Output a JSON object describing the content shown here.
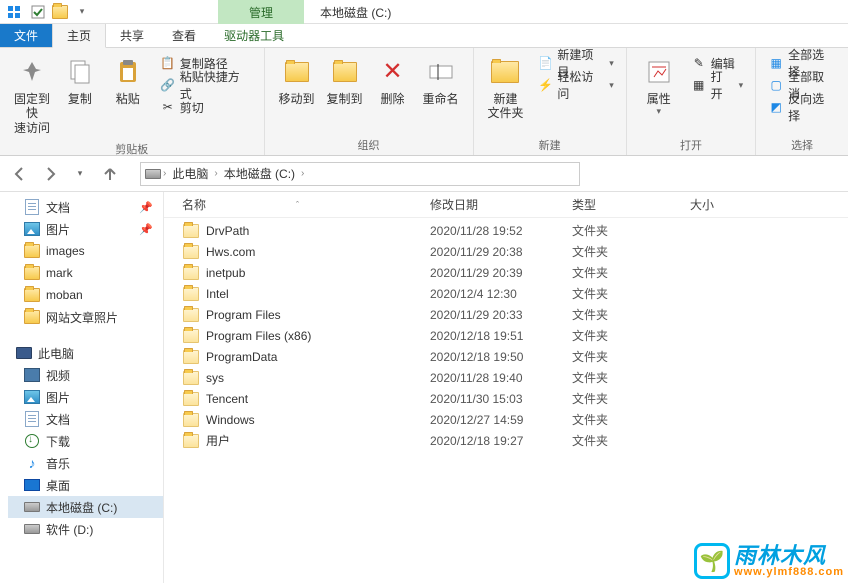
{
  "title": "本地磁盘 (C:)",
  "manage_label": "管理",
  "tabs": {
    "file": "文件",
    "home": "主页",
    "share": "共享",
    "view": "查看",
    "tools": "驱动器工具"
  },
  "ribbon": {
    "quick": {
      "pin": "固定到快\n速访问",
      "copy": "复制",
      "paste": "粘贴",
      "copypath": "复制路径",
      "pasteshortcut": "粘贴快捷方式",
      "cut": "剪切",
      "group": "剪贴板"
    },
    "org": {
      "moveto": "移动到",
      "copyto": "复制到",
      "delete": "删除",
      "rename": "重命名",
      "group": "组织"
    },
    "new": {
      "newfolder": "新建\n文件夹",
      "newitem": "新建项目",
      "easyaccess": "轻松访问",
      "group": "新建"
    },
    "open": {
      "props": "属性",
      "edit": "编辑",
      "open": "打开",
      "group": "打开"
    },
    "select": {
      "all": "全部选择",
      "none": "全部取消",
      "invert": "反向选择",
      "group": "选择"
    }
  },
  "breadcrumb": {
    "pc": "此电脑",
    "drive": "本地磁盘 (C:)"
  },
  "nav": {
    "items": [
      {
        "label": "文档",
        "icon": "doc",
        "pin": true
      },
      {
        "label": "图片",
        "icon": "pic",
        "pin": true
      },
      {
        "label": "images",
        "icon": "folder"
      },
      {
        "label": "mark",
        "icon": "folder"
      },
      {
        "label": "moban",
        "icon": "folder"
      },
      {
        "label": "网站文章照片",
        "icon": "folder"
      }
    ],
    "pc_label": "此电脑",
    "pc_items": [
      {
        "label": "视频",
        "icon": "video"
      },
      {
        "label": "图片",
        "icon": "pic"
      },
      {
        "label": "文档",
        "icon": "doc"
      },
      {
        "label": "下载",
        "icon": "down"
      },
      {
        "label": "音乐",
        "icon": "music"
      },
      {
        "label": "桌面",
        "icon": "desk"
      },
      {
        "label": "本地磁盘 (C:)",
        "icon": "disk",
        "selected": true
      },
      {
        "label": "软件 (D:)",
        "icon": "disk"
      }
    ]
  },
  "columns": {
    "name": "名称",
    "date": "修改日期",
    "type": "类型",
    "size": "大小"
  },
  "files": [
    {
      "name": "DrvPath",
      "date": "2020/11/28 19:52",
      "type": "文件夹"
    },
    {
      "name": "Hws.com",
      "date": "2020/11/29 20:38",
      "type": "文件夹"
    },
    {
      "name": "inetpub",
      "date": "2020/11/29 20:39",
      "type": "文件夹"
    },
    {
      "name": "Intel",
      "date": "2020/12/4 12:30",
      "type": "文件夹"
    },
    {
      "name": "Program Files",
      "date": "2020/11/29 20:33",
      "type": "文件夹"
    },
    {
      "name": "Program Files (x86)",
      "date": "2020/12/18 19:51",
      "type": "文件夹"
    },
    {
      "name": "ProgramData",
      "date": "2020/12/18 19:50",
      "type": "文件夹"
    },
    {
      "name": "sys",
      "date": "2020/11/28 19:40",
      "type": "文件夹"
    },
    {
      "name": "Tencent",
      "date": "2020/11/30 15:03",
      "type": "文件夹"
    },
    {
      "name": "Windows",
      "date": "2020/12/27 14:59",
      "type": "文件夹"
    },
    {
      "name": "用户",
      "date": "2020/12/18 19:27",
      "type": "文件夹"
    }
  ],
  "watermark": {
    "cn": "雨林木风",
    "url": "www.ylmf888.com"
  }
}
